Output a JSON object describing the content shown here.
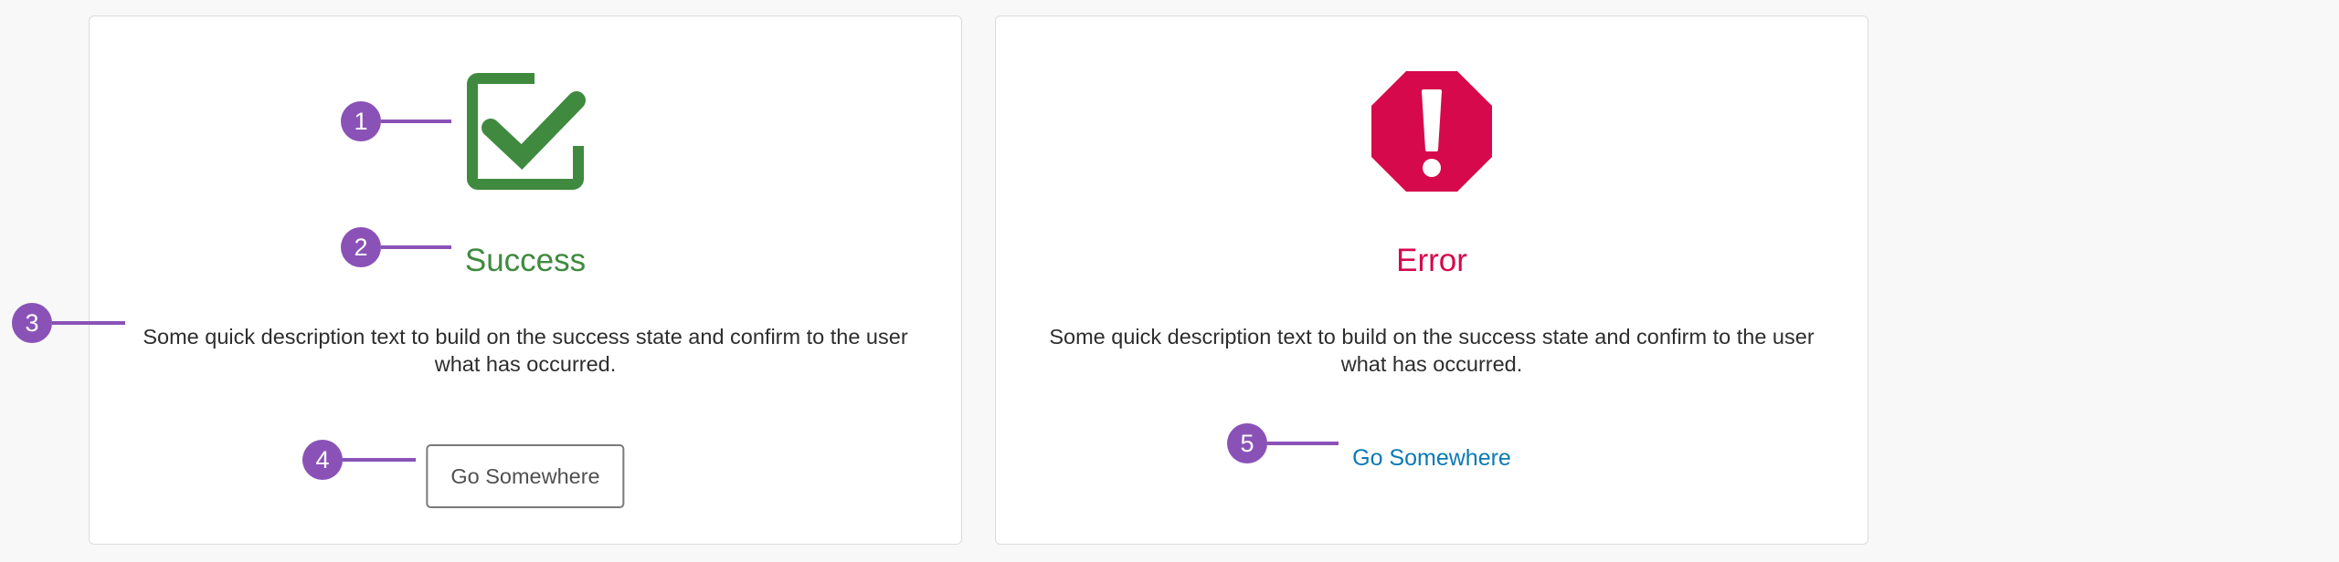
{
  "success_card": {
    "icon": "checked-box-icon",
    "color": "#3f8a3f",
    "title": "Success",
    "description": "Some quick description text to build on the success state and confirm to the user what has occurred.",
    "button_label": "Go Somewhere"
  },
  "error_card": {
    "icon": "octagon-exclamation-icon",
    "color": "#d5094b",
    "title": "Error",
    "description": "Some quick description text to build on the success state and confirm to the user what has occurred.",
    "link_label": "Go Somewhere",
    "link_color": "#0b7ab4"
  },
  "callouts": {
    "color": "#8a52b7",
    "items": [
      "1",
      "2",
      "3",
      "4",
      "5"
    ]
  }
}
